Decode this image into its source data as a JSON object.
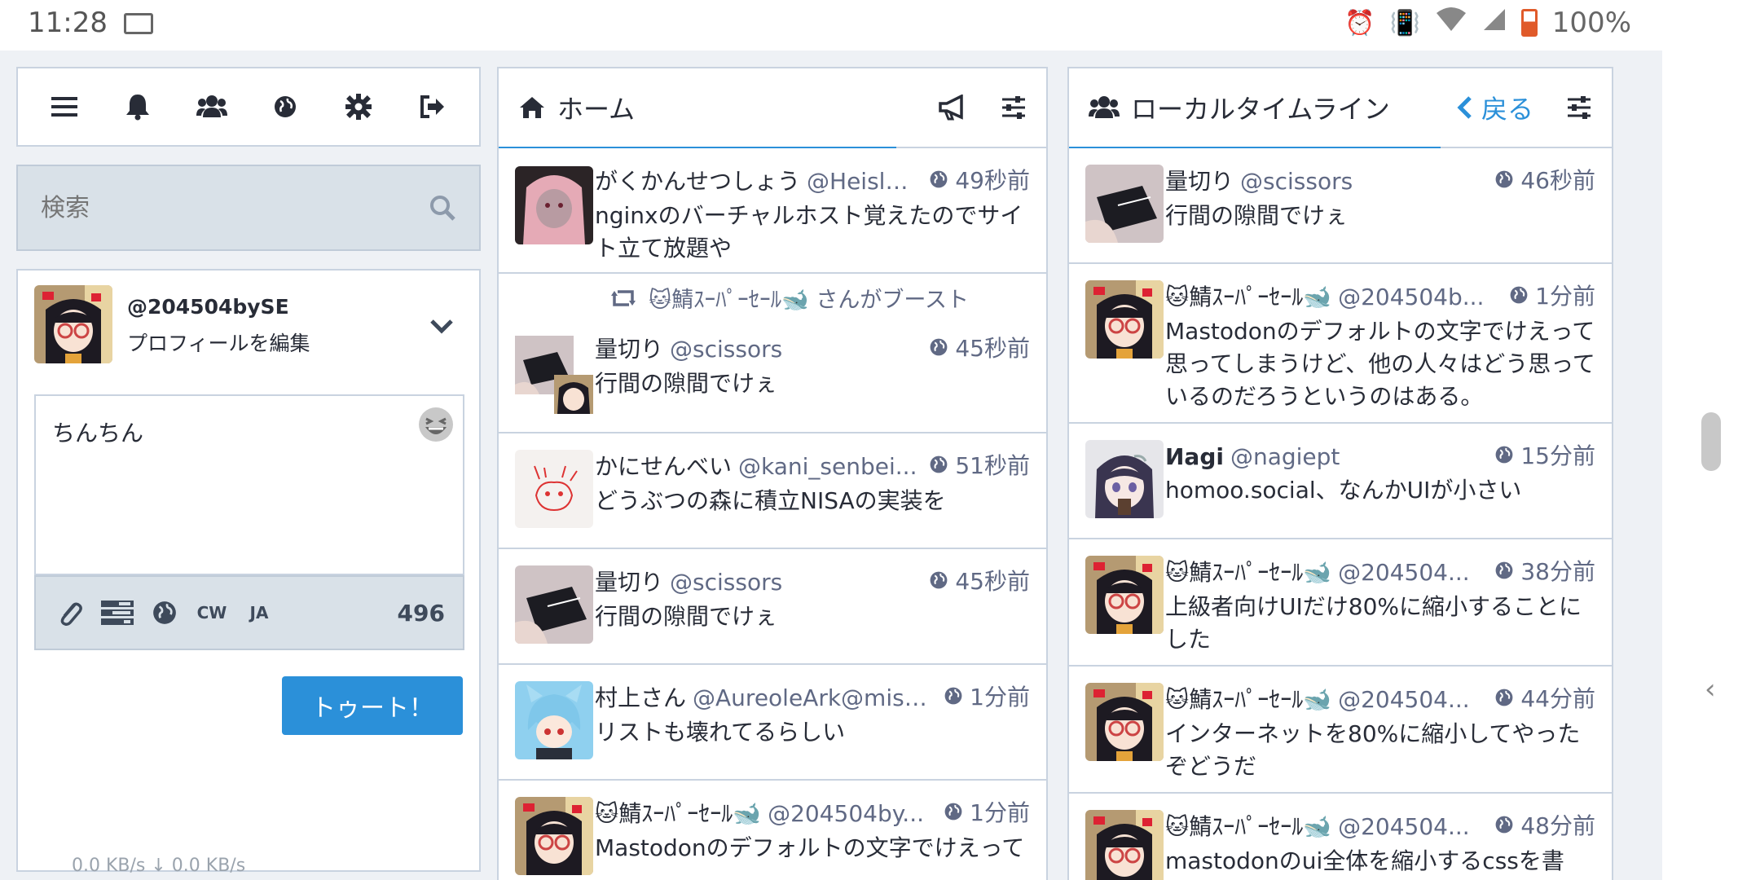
{
  "statusbar": {
    "time": "11:28",
    "battery": "100%"
  },
  "nav": {
    "icons": [
      "menu-icon",
      "bell-icon",
      "users-icon",
      "globe-icon",
      "gear-icon",
      "sign-out-icon"
    ]
  },
  "search": {
    "placeholder": "検索"
  },
  "compose": {
    "handle": "@204504bySE",
    "edit_profile": "プロフィールを編集",
    "text": "ちんちん",
    "tools": {
      "cw": "CW",
      "lang": "JA"
    },
    "count": "496",
    "toot": "トゥート！"
  },
  "home": {
    "title": "ホーム",
    "statuses": [
      {
        "name": "がくかんせつしょう",
        "acct": "@Heislan...",
        "time": "49秒前",
        "content": "nginxのバーチャルホスト覚えたのでサイト立て放題や"
      },
      {
        "boost_by": "🐱鯖ｽｰﾊﾟｰｾｰﾙ🐋 さんがブースト",
        "name": "量切り",
        "acct": "@scissors",
        "time": "45秒前",
        "content": "行間の隙間でけぇ"
      },
      {
        "name": "かにせんべい",
        "acct": "@kani_senbei...",
        "time": "51秒前",
        "content": "どうぶつの森に積立NISAの実装を"
      },
      {
        "name": "量切り",
        "acct": "@scissors",
        "time": "45秒前",
        "content": "行間の隙間でけぇ"
      },
      {
        "name": "村上さん",
        "acct": "@AureoleArk@missk...",
        "time": "1分前",
        "content": "リストも壊れてるらしい"
      },
      {
        "name": "🐱鯖ｽｰﾊﾟｰｾｰﾙ🐋",
        "acct": "@204504by...",
        "time": "1分前",
        "content": "Mastodonのデフォルトの文字でけえって"
      }
    ]
  },
  "local": {
    "title": "ローカルタイムライン",
    "back": "戻る",
    "statuses": [
      {
        "name": "量切り",
        "acct": "@scissors",
        "time": "46秒前",
        "content": "行間の隙間でけぇ"
      },
      {
        "name": "🐱鯖ｽｰﾊﾟｰｾｰﾙ🐋",
        "acct": "@204504b...",
        "time": "1分前",
        "content": "Mastodonのデフォルトの文字でけえって思ってしまうけど、他の人々はどう思っているのだろうというのはある。"
      },
      {
        "name": "Иagi",
        "acct": "@nagiept",
        "time": "15分前",
        "content": "homoo.social、なんかUIが小さい"
      },
      {
        "name": "🐱鯖ｽｰﾊﾟｰｾｰﾙ🐋",
        "acct": "@204504...",
        "time": "38分前",
        "content": "上級者向けUIだけ80%に縮小することにした"
      },
      {
        "name": "🐱鯖ｽｰﾊﾟｰｾｰﾙ🐋",
        "acct": "@204504...",
        "time": "44分前",
        "content": "インターネットを80%に縮小してやったぞどうだ"
      },
      {
        "name": "🐱鯖ｽｰﾊﾟｰｾｰﾙ🐋",
        "acct": "@204504...",
        "time": "48分前",
        "content": "mastodonのui全体を縮小するcssを書"
      }
    ]
  },
  "footer": {
    "net": "0.0 KB/s ↓    0.0 KB/s"
  }
}
